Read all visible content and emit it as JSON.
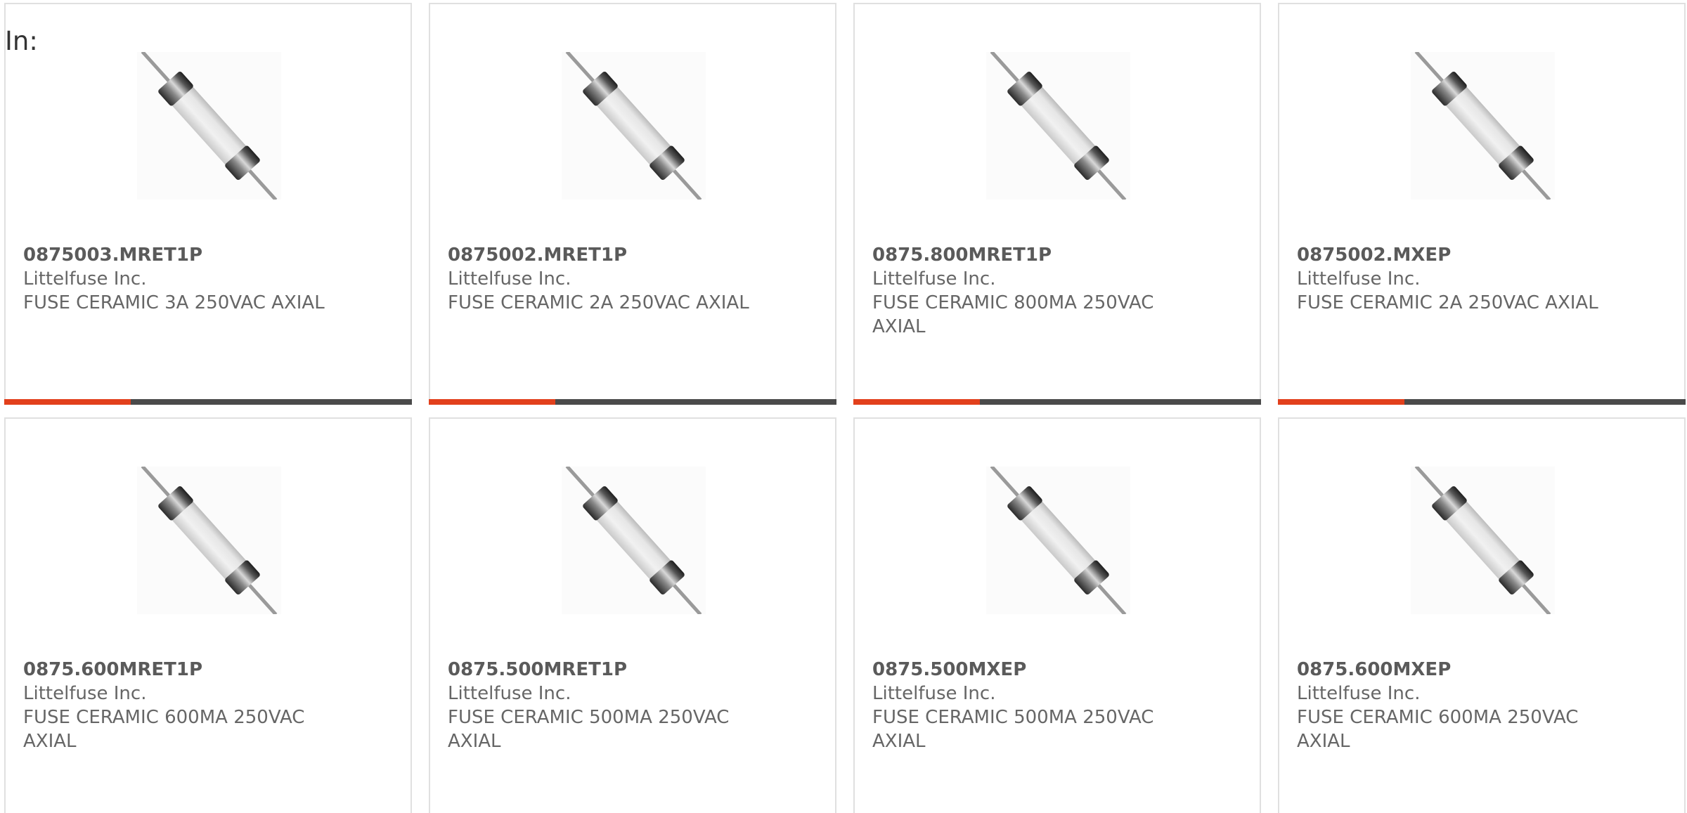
{
  "header": {
    "in_label": "In:"
  },
  "colors": {
    "accent": "#e2401c",
    "bar_track": "#4a4a4a",
    "text": "#666666",
    "border": "#e0e0e0"
  },
  "products": [
    {
      "part": "0875003.MRET1P",
      "manufacturer": "Littelfuse Inc.",
      "description": "FUSE CERAMIC 3A 250VAC AXIAL",
      "icon": "axial-fuse-image",
      "progress": 0.31
    },
    {
      "part": "0875002.MRET1P",
      "manufacturer": "Littelfuse Inc.",
      "description": "FUSE CERAMIC 2A 250VAC AXIAL",
      "icon": "axial-fuse-image",
      "progress": 0.31
    },
    {
      "part": "0875.800MRET1P",
      "manufacturer": "Littelfuse Inc.",
      "description": "FUSE CERAMIC 800MA 250VAC AXIAL",
      "icon": "axial-fuse-image",
      "progress": 0.31
    },
    {
      "part": "0875002.MXEP",
      "manufacturer": "Littelfuse Inc.",
      "description": "FUSE CERAMIC 2A 250VAC AXIAL",
      "icon": "axial-fuse-image",
      "progress": 0.31
    },
    {
      "part": "0875.600MRET1P",
      "manufacturer": "Littelfuse Inc.",
      "description": "FUSE CERAMIC 600MA 250VAC AXIAL",
      "icon": "axial-fuse-image",
      "progress": null
    },
    {
      "part": "0875.500MRET1P",
      "manufacturer": "Littelfuse Inc.",
      "description": "FUSE CERAMIC 500MA 250VAC AXIAL",
      "icon": "axial-fuse-image",
      "progress": null
    },
    {
      "part": "0875.500MXEP",
      "manufacturer": "Littelfuse Inc.",
      "description": "FUSE CERAMIC 500MA 250VAC AXIAL",
      "icon": "axial-fuse-image",
      "progress": null
    },
    {
      "part": "0875.600MXEP",
      "manufacturer": "Littelfuse Inc.",
      "description": "FUSE CERAMIC 600MA 250VAC AXIAL",
      "icon": "axial-fuse-image",
      "progress": null
    }
  ]
}
